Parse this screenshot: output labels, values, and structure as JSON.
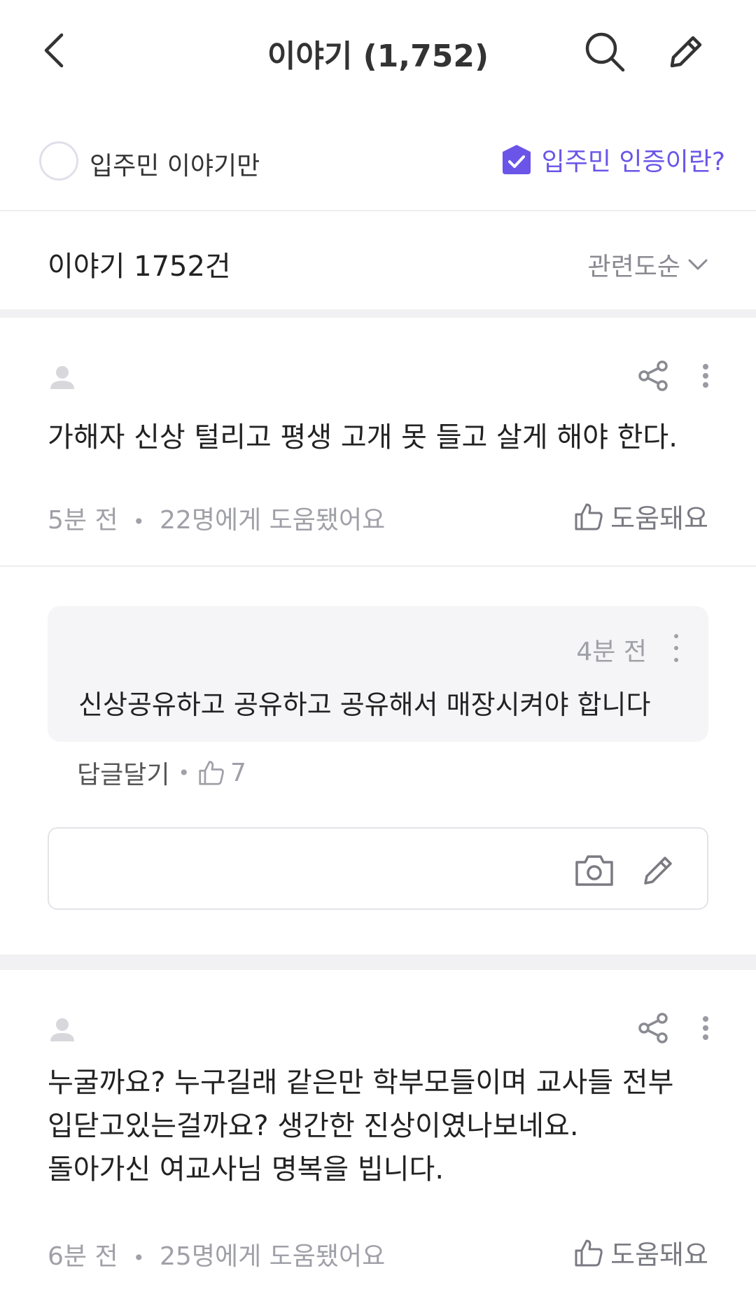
{
  "header": {
    "title": "이야기 (1,752)"
  },
  "filter": {
    "residents_only_label": "입주민 이야기만",
    "verify_link": "입주민 인증이란?"
  },
  "list": {
    "count_label": "이야기 1752건",
    "sort_label": "관련도순"
  },
  "posts": [
    {
      "body": "가해자 신상 털리고 평생 고개 못 들고 살게 해야 한다.",
      "time": "5분 전",
      "helpful_count": "22명에게 도움됐어요",
      "helpful_button": "도움돼요"
    },
    {
      "body": "누굴까요? 누구길래 같은만 학부모들이며 교사들 전부\n입닫고있는걸까요? 생간한 진상이였나보네요.\n돌아가신 여교사님 명복을 빕니다.",
      "time": "6분 전",
      "helpful_count": "25명에게 도움됐어요",
      "helpful_button": "도움돼요"
    }
  ],
  "comment": {
    "time": "4분 전",
    "text": "신상공유하고 공유하고 공유해서 매장시켜야 합니다",
    "reply_label": "답글달기",
    "like_count": "7"
  },
  "meta_separator": "•",
  "colors": {
    "accent": "#6a55e8",
    "muted_text": "#a0a0a8",
    "divider": "#f1f1f3"
  },
  "icons": [
    "back-arrow-icon",
    "search-icon",
    "pencil-icon",
    "shield-check-icon",
    "chevron-down-icon",
    "user-icon",
    "share-icon",
    "more-vertical-icon",
    "thumbs-up-icon",
    "camera-icon"
  ]
}
